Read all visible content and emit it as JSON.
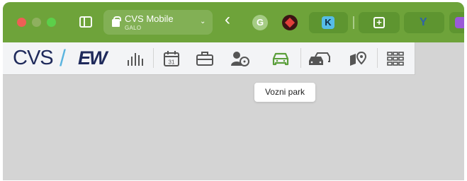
{
  "browser": {
    "tab_group": {
      "title": "CVS Mobile",
      "subtitle": "GALO",
      "chevron": "⌄"
    },
    "back_glyph": "‹",
    "extensions": {
      "grammarly_glyph": "G",
      "k_glyph": "K",
      "plus_glyph": "+",
      "y_glyph": "Y"
    }
  },
  "app": {
    "logo": {
      "cvs": "CVS",
      "slash": "/",
      "ew": "EW"
    },
    "nav_icons": [
      "bar-chart-icon",
      "calendar-icon",
      "briefcase-icon",
      "driver-icon",
      "car-icon",
      "cars-icon",
      "map-pin-icon",
      "grid-icon"
    ],
    "calendar_day": "31",
    "active_icon": "car-icon",
    "active_color": "#5a9e3a",
    "tooltip": "Vozni park"
  },
  "colors": {
    "titlebar": "#6ea33a",
    "brand_navy": "#1f2a5b",
    "brand_blue": "#5ab4df"
  }
}
